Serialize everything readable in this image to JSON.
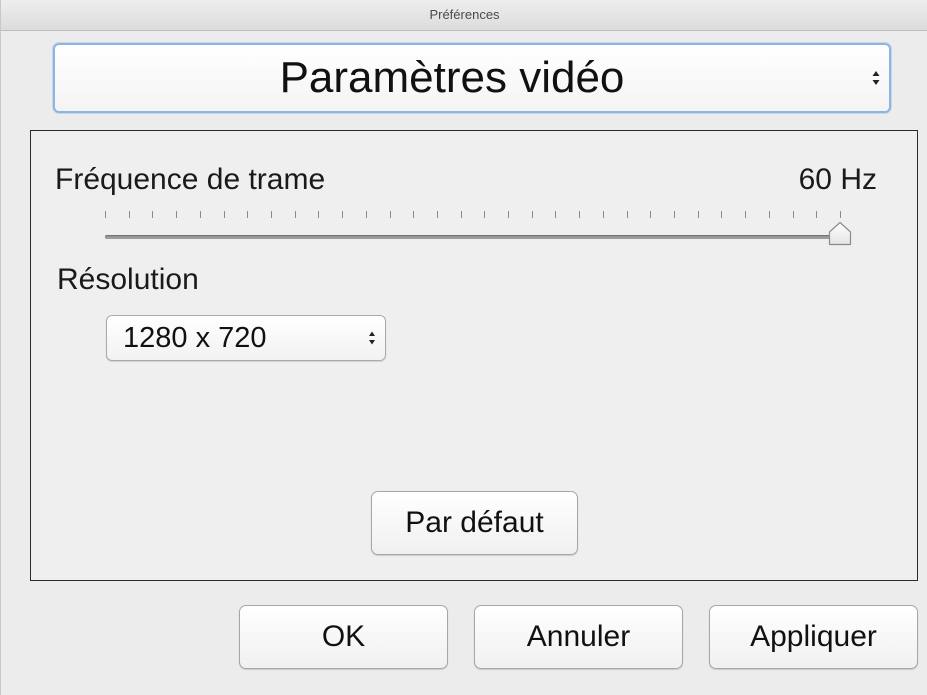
{
  "window": {
    "title": "Préférences"
  },
  "panel_select": {
    "value": "Paramètres vidéo",
    "icon": "updown-arrows-icon"
  },
  "video_settings": {
    "framerate": {
      "label": "Fréquence de trame",
      "value_text": "60 Hz",
      "slider_fraction": 1.0,
      "tick_count": 32
    },
    "resolution": {
      "label": "Résolution",
      "selected": "1280 x 720",
      "icon": "updown-arrows-icon"
    },
    "default_button_label": "Par défaut"
  },
  "footer": {
    "ok_label": "OK",
    "cancel_label": "Annuler",
    "apply_label": "Appliquer"
  },
  "colors": {
    "focus_ring": "#8fb4df",
    "window_bg": "#ececec"
  }
}
